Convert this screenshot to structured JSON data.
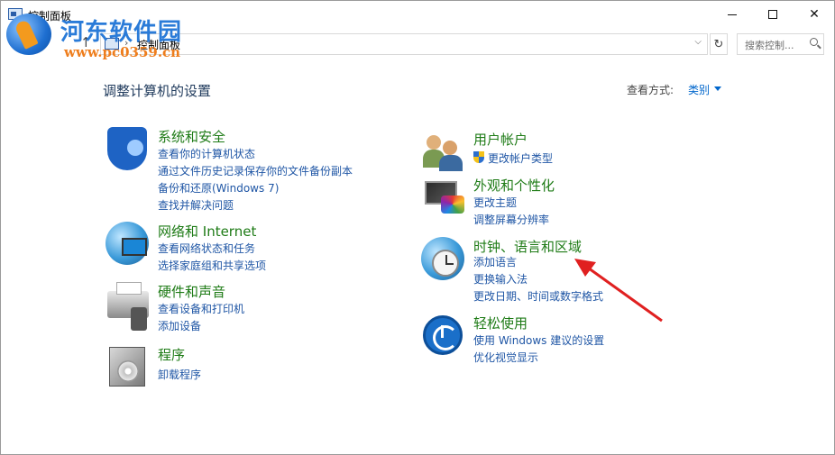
{
  "window": {
    "title": "控制面板"
  },
  "nav": {
    "back_glyph": "←",
    "up_glyph": "↑"
  },
  "address": {
    "path": "控制面板",
    "separator": "›"
  },
  "search": {
    "placeholder": "搜索控制..."
  },
  "watermark": {
    "title": "河东软件园",
    "url": "www.pc0359.cn"
  },
  "header": {
    "page_title": "调整计算机的设置",
    "view_by_label": "查看方式:",
    "view_by_value": "类别"
  },
  "categories": [
    {
      "title": "系统和安全",
      "icon": "shield-icon",
      "links": [
        "查看你的计算机状态",
        "通过文件历史记录保存你的文件备份副本",
        "备份和还原(Windows 7)",
        "查找并解决问题"
      ]
    },
    {
      "title": "网络和 Internet",
      "icon": "network-globe-icon",
      "links": [
        "查看网络状态和任务",
        "选择家庭组和共享选项"
      ]
    },
    {
      "title": "硬件和声音",
      "icon": "printer-icon",
      "links": [
        "查看设备和打印机",
        "添加设备"
      ]
    },
    {
      "title": "程序",
      "icon": "programs-icon",
      "links": [
        "卸载程序"
      ]
    },
    {
      "title": "用户帐户",
      "icon": "users-icon",
      "links": [
        "更改帐户类型"
      ]
    },
    {
      "title": "外观和个性化",
      "icon": "appearance-icon",
      "links": [
        "更改主题",
        "调整屏幕分辨率"
      ]
    },
    {
      "title": "时钟、语言和区域",
      "icon": "clock-globe-icon",
      "links": [
        "添加语言",
        "更换输入法",
        "更改日期、时间或数字格式"
      ]
    },
    {
      "title": "轻松使用",
      "icon": "ease-of-access-icon",
      "links": [
        "使用 Windows 建议的设置",
        "优化视觉显示"
      ]
    }
  ],
  "colors": {
    "category_title": "#1e7b16",
    "link": "#1f56a5",
    "page_title": "#1e395b",
    "annotation_arrow": "#e02020"
  }
}
